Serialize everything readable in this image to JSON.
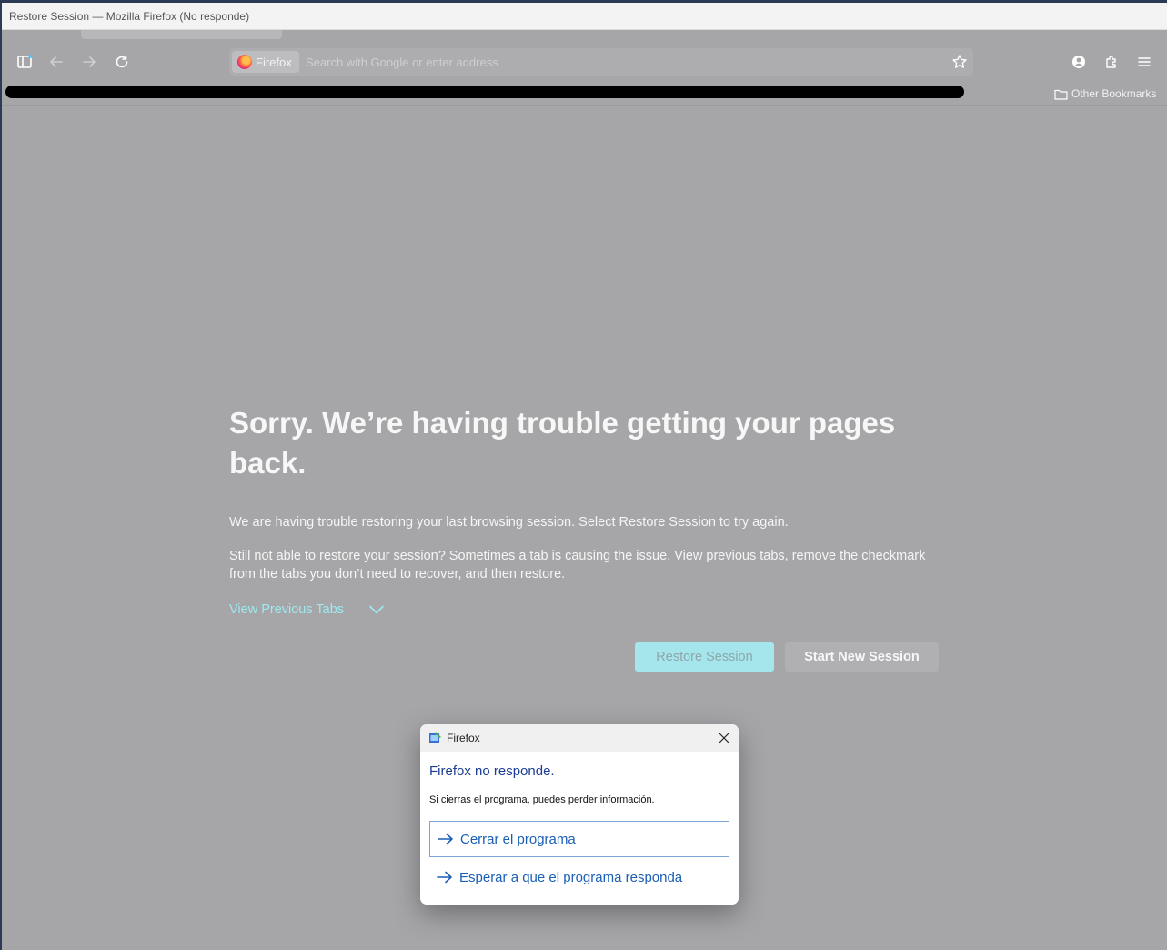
{
  "window": {
    "title": "Restore Session — Mozilla Firefox (No responde)"
  },
  "toolbar": {
    "identity_label": "Firefox",
    "address_placeholder": "Search with Google or enter address",
    "icons": [
      "sidebar-icon",
      "back-arrow-icon",
      "forward-arrow-icon",
      "reload-icon",
      "bookmark-star-icon",
      "account-icon",
      "extensions-icon",
      "menu-icon"
    ]
  },
  "bookmarks": {
    "other_bookmarks_label": "Other Bookmarks"
  },
  "page": {
    "headline": "Sorry. We’re having trouble getting your pages back.",
    "para1": "We are having trouble restoring your last browsing session. Select Restore Session to try again.",
    "para2": "Still not able to restore your session? Sometimes a tab is causing the issue. View previous tabs, remove the checkmark from the tabs you don’t need to recover, and then restore.",
    "view_previous_tabs": "View Previous Tabs",
    "restore_button": "Restore Session",
    "new_session_button": "Start New Session"
  },
  "dialog": {
    "app_name": "Firefox",
    "heading": "Firefox no responde.",
    "message": "Si cierras el programa, puedes perder información.",
    "option_close": "Cerrar el programa",
    "option_wait": "Esperar a que el programa responda"
  },
  "colors": {
    "page_background": "#a6a6a9",
    "link_accent": "#9de9f0",
    "restore_button": "#a4e6ec",
    "dialog_heading": "#1c3d94",
    "dialog_link": "#1a5fb4"
  }
}
